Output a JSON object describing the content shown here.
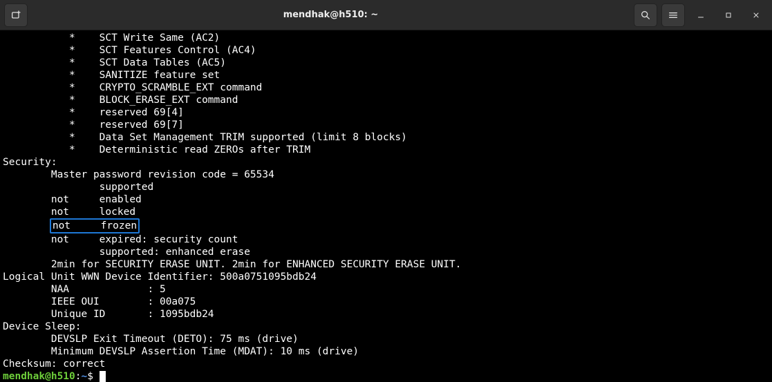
{
  "window": {
    "title": "mendhak@h510: ~"
  },
  "terminal": {
    "lines": [
      "           *    SCT Write Same (AC2)",
      "           *    SCT Features Control (AC4)",
      "           *    SCT Data Tables (AC5)",
      "           *    SANITIZE feature set",
      "           *    CRYPTO_SCRAMBLE_EXT command",
      "           *    BLOCK_ERASE_EXT command",
      "           *    reserved 69[4]",
      "           *    reserved 69[7]",
      "           *    Data Set Management TRIM supported (limit 8 blocks)",
      "           *    Deterministic read ZEROs after TRIM",
      "Security: ",
      "        Master password revision code = 65534",
      "                supported",
      "        not     enabled",
      "        not     locked",
      "        not     frozen",
      "        not     expired: security count",
      "                supported: enhanced erase",
      "        2min for SECURITY ERASE UNIT. 2min for ENHANCED SECURITY ERASE UNIT.",
      "Logical Unit WWN Device Identifier: 500a0751095bdb24",
      "        NAA             : 5",
      "        IEEE OUI        : 00a075",
      "        Unique ID       : 1095bdb24",
      "Device Sleep:",
      "        DEVSLP Exit Timeout (DETO): 75 ms (drive)",
      "        Minimum DEVSLP Assertion Time (MDAT): 10 ms (drive)",
      "Checksum: correct"
    ],
    "highlight_index": 15,
    "highlight_prefix": "        ",
    "highlight_text": "not     frozen",
    "prompt": {
      "user_host": "mendhak@h510",
      "separator": ":",
      "path": "~",
      "symbol": "$"
    }
  }
}
